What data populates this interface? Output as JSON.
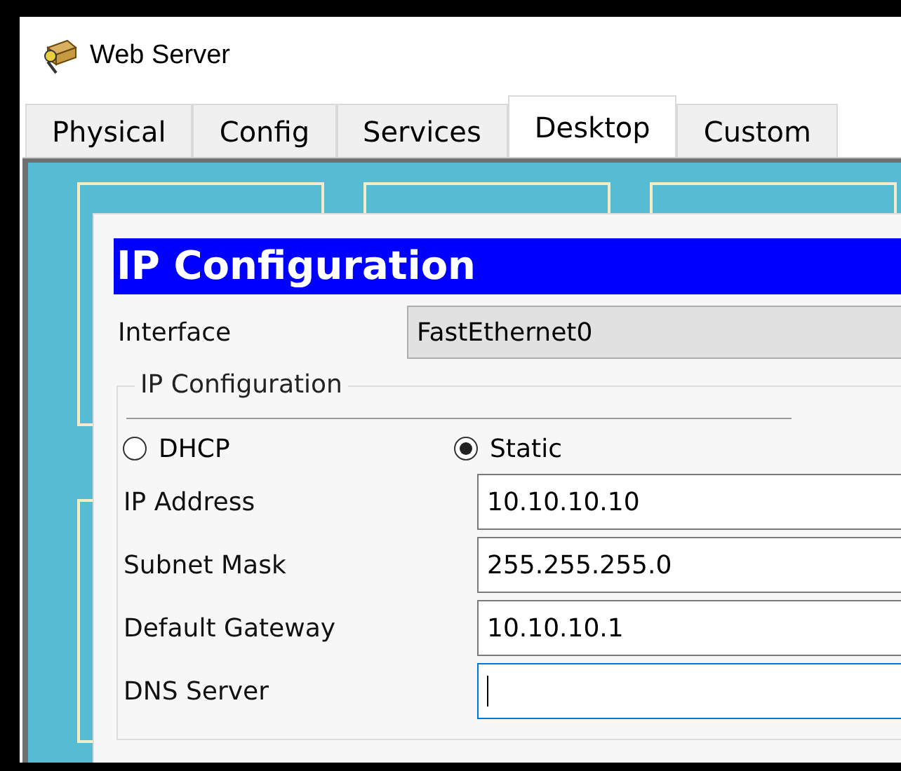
{
  "window": {
    "title": "Web Server"
  },
  "tabs": [
    {
      "label": "Physical",
      "selected": false
    },
    {
      "label": "Config",
      "selected": false
    },
    {
      "label": "Services",
      "selected": false
    },
    {
      "label": "Desktop",
      "selected": true
    },
    {
      "label": "Custom",
      "selected": false
    }
  ],
  "dialog": {
    "title": "IP Configuration",
    "interface": {
      "label": "Interface",
      "value": "FastEthernet0"
    },
    "group": {
      "legend": "IP Configuration",
      "radios": [
        {
          "label": "DHCP",
          "selected": false
        },
        {
          "label": "Static",
          "selected": true
        }
      ],
      "fields": [
        {
          "label": "IP Address",
          "value": "10.10.10.10",
          "focused": false
        },
        {
          "label": "Subnet Mask",
          "value": "255.255.255.0",
          "focused": false
        },
        {
          "label": "Default Gateway",
          "value": "10.10.10.1",
          "focused": false
        },
        {
          "label": "DNS Server",
          "focused": true
        }
      ]
    }
  }
}
